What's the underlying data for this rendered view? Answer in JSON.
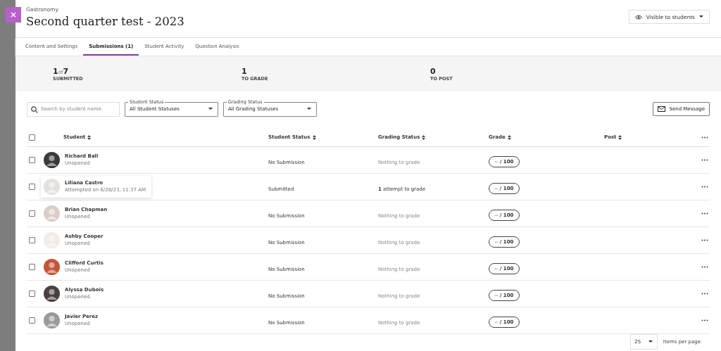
{
  "header": {
    "breadcrumb": "Gastronomy",
    "title": "Second quarter test - 2023",
    "visibility": "Visible to students"
  },
  "tabs": [
    {
      "label": "Content and Settings",
      "selected": false
    },
    {
      "label": "Submissions (1)",
      "selected": true
    },
    {
      "label": "Student Activity",
      "selected": false
    },
    {
      "label": "Question Analysis",
      "selected": false
    }
  ],
  "stats": [
    {
      "value": "1",
      "of": "of",
      "total": "7",
      "label": "SUBMITTED"
    },
    {
      "value": "1",
      "label": "TO GRADE"
    },
    {
      "value": "0",
      "label": "TO POST"
    }
  ],
  "filters": {
    "search_placeholder": "Search by student name",
    "student_status": {
      "label": "Student Status",
      "value": "All Student Statuses"
    },
    "grading_status": {
      "label": "Grading Status",
      "value": "All Grading Statuses"
    },
    "send_message": "Send Message"
  },
  "table": {
    "select_all_checked": false,
    "columns": [
      "Student",
      "Student Status",
      "Grading Status",
      "Grade",
      "Post"
    ],
    "rows": [
      {
        "name": "Richard Ball",
        "detail": "Unopened",
        "color": "#3a3a3a",
        "checked": false,
        "hovered": false,
        "student_status": "No Submission",
        "grading_status": "Nothing to grade",
        "pending": false,
        "grade": "-- **/ 100**"
      },
      {
        "name": "Liliana Castro",
        "detail": "Attempted on 6/28/23, 11:37 AM",
        "color": "#e4e0de",
        "checked": false,
        "hovered": true,
        "student_status": "Submitted",
        "grading_status": "**1** attempt to grade",
        "pending": true,
        "grade": "-- **/ 100**"
      },
      {
        "name": "Brian Chapman",
        "detail": "Unopened",
        "color": "#d9cfc8",
        "checked": false,
        "hovered": false,
        "student_status": "No Submission",
        "grading_status": "Nothing to grade",
        "pending": false,
        "grade": "-- **/ 100**"
      },
      {
        "name": "Ashby Cooper",
        "detail": "Unopened",
        "color": "#f1ece8",
        "checked": false,
        "hovered": false,
        "student_status": "No Submission",
        "grading_status": "Nothing to grade",
        "pending": false,
        "grade": "-- **/ 100**"
      },
      {
        "name": "Clifford Curtis",
        "detail": "Unopened",
        "color": "#c4553a",
        "checked": false,
        "hovered": false,
        "student_status": "No Submission",
        "grading_status": "Nothing to grade",
        "pending": false,
        "grade": "-- **/ 100**"
      },
      {
        "name": "Alyssa Dubois",
        "detail": "Unopened",
        "color": "#4a4040",
        "checked": false,
        "hovered": false,
        "student_status": "No Submission",
        "grading_status": "Nothing to grade",
        "pending": false,
        "grade": "-- **/ 100**"
      },
      {
        "name": "Javier Perez",
        "detail": "Unopened",
        "color": "#9a9a9a",
        "checked": false,
        "hovered": false,
        "student_status": "No Submission",
        "grading_status": "Nothing to grade",
        "pending": false,
        "grade": "-- **/ 100**"
      }
    ]
  },
  "pagination": {
    "per_page": "25",
    "label": "Items per page"
  }
}
